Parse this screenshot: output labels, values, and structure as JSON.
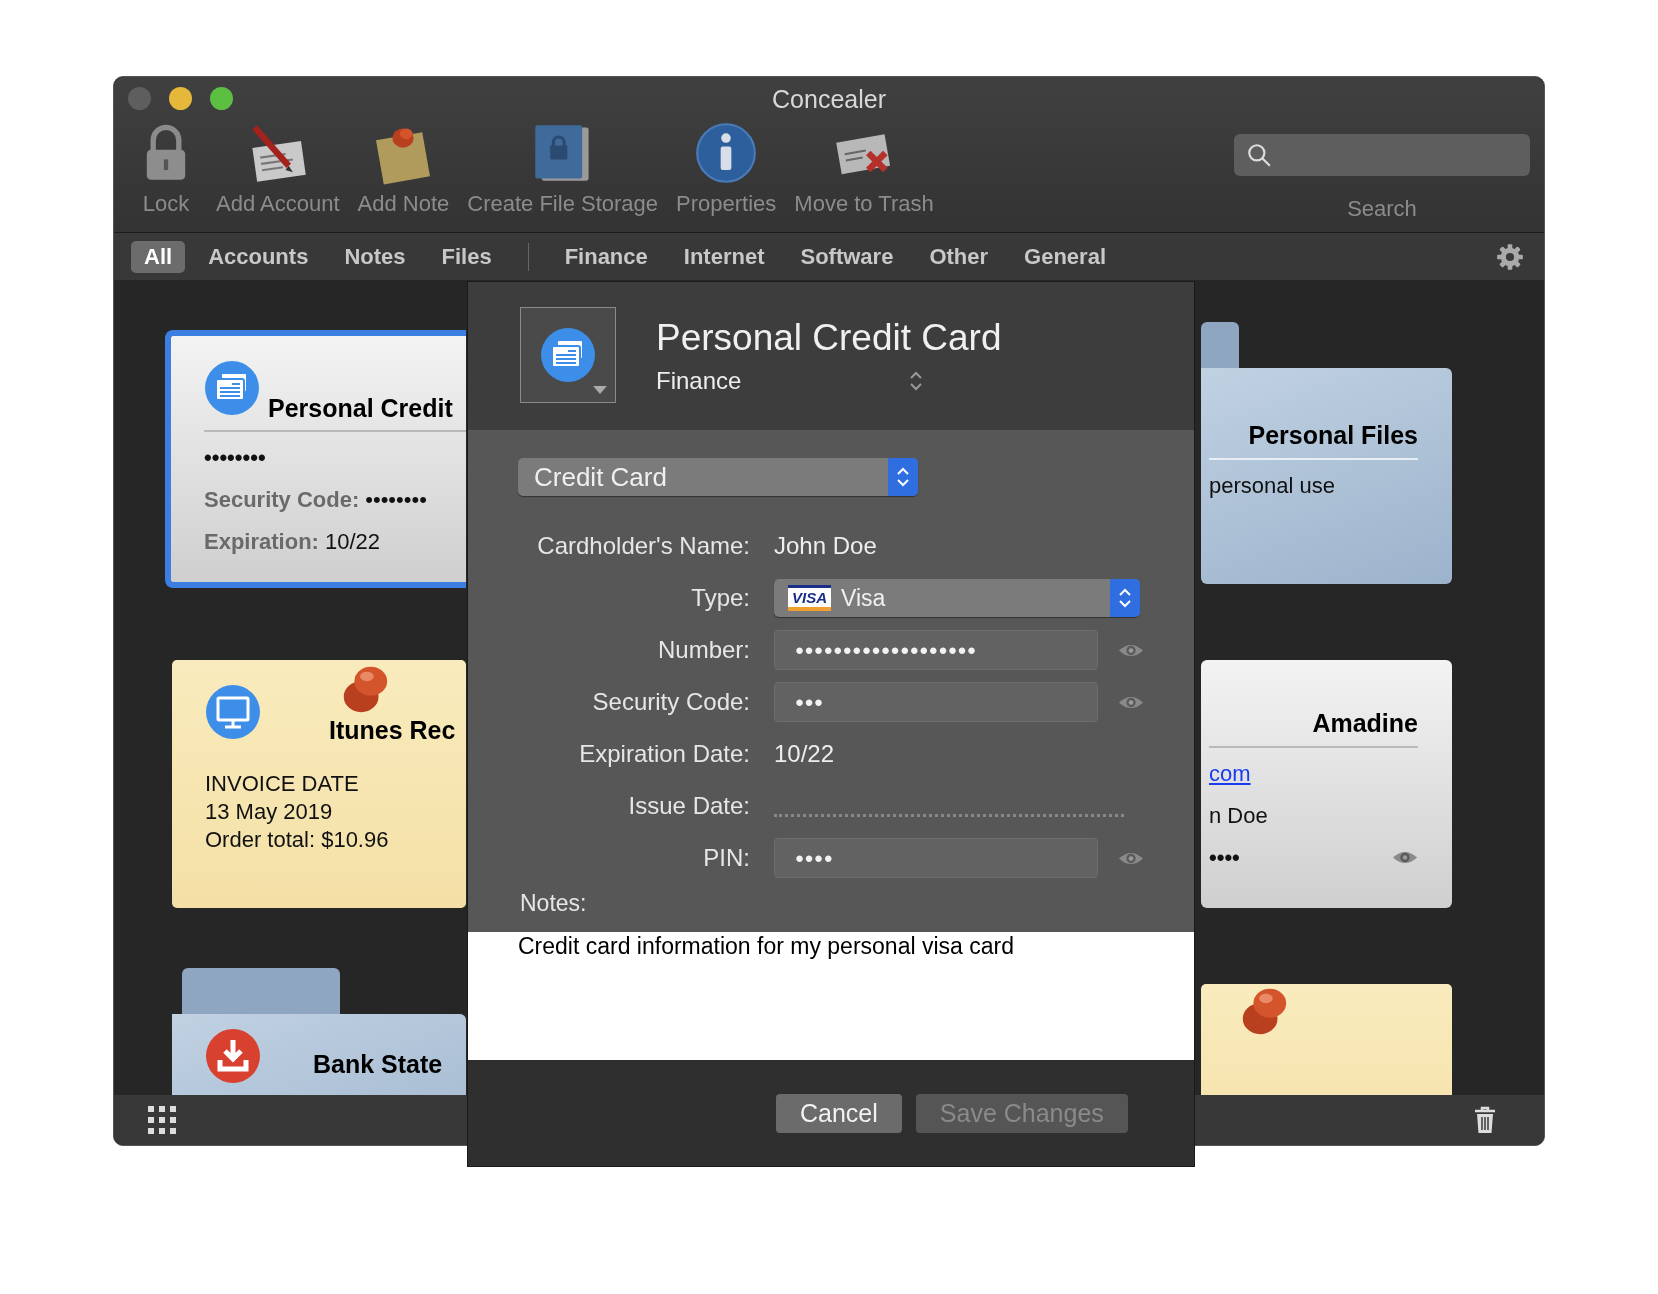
{
  "window": {
    "title": "Concealer",
    "traffic_lights": [
      {
        "color": "#5e5e5e"
      },
      {
        "color": "#e5b83b"
      },
      {
        "color": "#5cbf42"
      }
    ]
  },
  "toolbar": {
    "items": [
      {
        "label": "Lock",
        "kind": "lock"
      },
      {
        "label": "Add Account",
        "kind": "account"
      },
      {
        "label": "Add Note",
        "kind": "note"
      },
      {
        "label": "Create File Storage",
        "kind": "storage"
      },
      {
        "label": "Properties",
        "kind": "info"
      },
      {
        "label": "Move to Trash",
        "kind": "trash"
      }
    ],
    "search_label": "Search"
  },
  "filters": {
    "types": [
      {
        "label": "All",
        "selected": true
      },
      {
        "label": "Accounts",
        "selected": false
      },
      {
        "label": "Notes",
        "selected": false
      },
      {
        "label": "Files",
        "selected": false
      }
    ],
    "categories": [
      {
        "label": "Finance",
        "selected": false
      },
      {
        "label": "Internet",
        "selected": false
      },
      {
        "label": "Software",
        "selected": false
      },
      {
        "label": "Other",
        "selected": false
      },
      {
        "label": "General",
        "selected": false
      }
    ]
  },
  "cards_left": [
    {
      "kind": "account",
      "selected": true,
      "pinned": false,
      "title": "Personal Credit",
      "lines": [
        {
          "kind": "masked",
          "value": "••••••••"
        },
        {
          "kind": "labeled",
          "label": "Security Code:",
          "value": "••••••••"
        },
        {
          "kind": "labeled",
          "label": "Expiration:",
          "value": "10/22"
        }
      ]
    },
    {
      "kind": "note",
      "selected": false,
      "pinned": true,
      "title": "Itunes Rec",
      "lines": [
        {
          "kind": "plain",
          "value": "INVOICE DATE"
        },
        {
          "kind": "plain",
          "value": "13 May 2019"
        },
        {
          "kind": "plain",
          "value": "Order total: $10.96"
        }
      ]
    },
    {
      "kind": "folder",
      "selected": false,
      "pinned": false,
      "title": "Bank State"
    }
  ],
  "cards_right": [
    {
      "kind": "folder",
      "selected": false,
      "pinned": false,
      "title": "Personal Files",
      "lines": [
        {
          "kind": "plain",
          "value": "personal use"
        }
      ]
    },
    {
      "kind": "account",
      "selected": false,
      "pinned": false,
      "title": "Amadine",
      "lines": [
        {
          "kind": "link",
          "value": "com"
        },
        {
          "kind": "plain",
          "value": "n Doe"
        },
        {
          "kind": "secret",
          "value": "••••"
        }
      ]
    },
    {
      "kind": "note",
      "selected": false,
      "pinned": true
    }
  ],
  "dialog": {
    "title": "Personal Credit Card",
    "category": "Finance",
    "template": "Credit Card",
    "fields": [
      {
        "label": "Cardholder's Name:",
        "kind": "text",
        "value": "John Doe"
      },
      {
        "label": "Type:",
        "kind": "select",
        "value": "Visa",
        "logo": "VISA"
      },
      {
        "label": "Number:",
        "kind": "secret",
        "value": "●●●●●●●●●●●●●●●●●●●"
      },
      {
        "label": "Security Code:",
        "kind": "secret",
        "value": "●●●"
      },
      {
        "label": "Expiration Date:",
        "kind": "text",
        "value": "10/22"
      },
      {
        "label": "Issue Date:",
        "kind": "empty"
      },
      {
        "label": "PIN:",
        "kind": "secret",
        "value": "●●●●"
      }
    ],
    "notes_label": "Notes:",
    "notes": "Credit card information for my personal visa card",
    "buttons": [
      {
        "label": "Cancel",
        "disabled": false
      },
      {
        "label": "Save Changes",
        "disabled": true
      }
    ]
  }
}
